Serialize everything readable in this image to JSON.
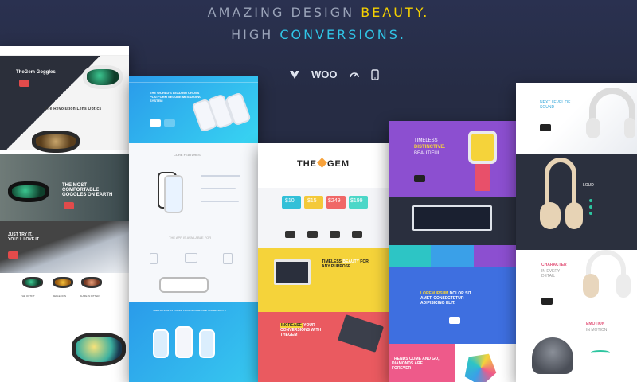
{
  "headline": {
    "line1_pre": "AMAZING DESIGN",
    "line1_accent": "BEAUTY.",
    "line2_pre": "HIGH",
    "line2_accent": "CONVERSIONS."
  },
  "badges": {
    "woo": "WOO"
  },
  "mock1": {
    "brand": "TheGem",
    "title": "TheGem Goggles",
    "section1": "The Revolution Lens Optics",
    "promo": "THE MOST COMFORTABLE GOGGLES ON EARTH",
    "try": "JUST TRY IT. YOU'LL LOVE IT.",
    "products": [
      "THE OUTFIT",
      "REFLEXION",
      "BLAZE IN FITTER"
    ]
  },
  "mock2": {
    "headline": "THE WORLD'S LEADING CROSS PLATFORM SECURE MESSAGING SYSTEM",
    "section": "CORE FEATURES",
    "section2": "THE APP IS AVAILABLE FOR",
    "section3": "THE PROVIDE AS VISIBLE FROM AN AWESOME SCREENSHOTS"
  },
  "mock3": {
    "logo_pre": "THE",
    "logo_post": "GEM",
    "prices": [
      "$10",
      "$15",
      "$249",
      "$199"
    ],
    "timeless": "TIMELESS",
    "beauty": "BEAUTY",
    "for": "FOR",
    "purpose": "ANY PURPOSE",
    "increase": "INCREASE",
    "your": "YOUR CONVERSIONS WITH THEGEM"
  },
  "mock4": {
    "t1": "TIMELESS",
    "t2": "DISTINCTIVE.",
    "t3": "BEAUTIFUL",
    "lorem": "LOREM IPSUM",
    "dolor": "DOLOR SIT AMET, CONSECTETUR ADIPISICING ELIT.",
    "trends": "TRENDS COME AND GO, DIAMONDS ARE FOREVER"
  },
  "mock5": {
    "next": "NEXT LEVEL OF SOUND",
    "loud": "LOUD",
    "character": "CHARACTER",
    "every": "IN EVERY DETAIL",
    "emotion": "EMOTION",
    "motion": "IN MOTION"
  }
}
